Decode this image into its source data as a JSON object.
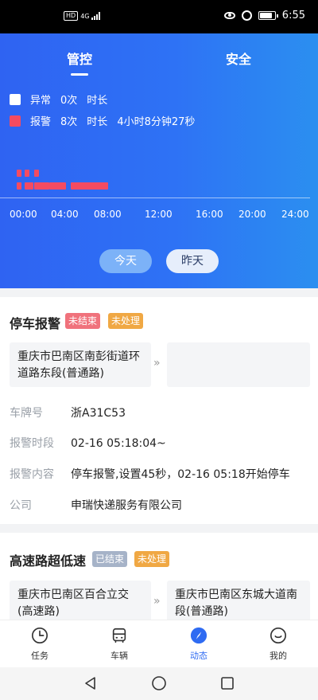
{
  "status_bar": {
    "signal_label": "HD",
    "network": "4G",
    "time": "6:55"
  },
  "tabs": [
    {
      "label": "管控",
      "active": true
    },
    {
      "label": "安全",
      "active": false
    }
  ],
  "legend": [
    {
      "name": "异常",
      "count": "0次",
      "duration_label": "时长",
      "duration": "",
      "color": "#ffffff"
    },
    {
      "name": "报警",
      "count": "8次",
      "duration_label": "时长",
      "duration": "4小时8分钟27秒",
      "color": "#f44b61"
    }
  ],
  "timeline": {
    "ticks": [
      "00:00",
      "04:00",
      "08:00",
      "12:00",
      "16:00",
      "20:00",
      "24:00"
    ],
    "alarm_events_hours": [
      {
        "start": 0.2,
        "end": 0.6,
        "row": 0
      },
      {
        "start": 0.9,
        "end": 1.3,
        "row": 0
      },
      {
        "start": 1.7,
        "end": 2.1,
        "row": 0
      },
      {
        "start": 0.2,
        "end": 0.6,
        "row": 1
      },
      {
        "start": 0.9,
        "end": 1.6,
        "row": 1
      },
      {
        "start": 1.7,
        "end": 3.0,
        "row": 1
      },
      {
        "start": 3.0,
        "end": 4.4,
        "row": 1
      },
      {
        "start": 4.8,
        "end": 8.0,
        "row": 1
      }
    ]
  },
  "day_buttons": {
    "today": "今天",
    "yesterday": "昨天"
  },
  "alarms": [
    {
      "title": "停车报警",
      "badges": [
        {
          "text": "未结束",
          "color": "#f0727c"
        },
        {
          "text": "未处理",
          "color": "#f0a844"
        }
      ],
      "start_location": "重庆市巴南区南彭街道环道路东段(普通路)",
      "end_location": "",
      "separator": "»",
      "fields": [
        {
          "label": "车牌号",
          "value": "浙A31C53"
        },
        {
          "label": "报警时段",
          "value": "02-16 05:18:04~"
        },
        {
          "label": "报警内容",
          "value": "停车报警,设置45秒，02-16 05:18开始停车"
        },
        {
          "label": "公司",
          "value": "申瑞快递服务有限公司"
        }
      ]
    },
    {
      "title": "高速路超低速",
      "badges": [
        {
          "text": "已结束",
          "color": "#a6b3c8"
        },
        {
          "text": "未处理",
          "color": "#f0a844"
        }
      ],
      "start_location": "重庆市巴南区百合立交(高速路)",
      "end_location": "重庆市巴南区东城大道南段(普通路)",
      "separator": "»"
    }
  ],
  "bottom_nav": [
    {
      "label": "任务",
      "icon": "clock-icon",
      "active": false
    },
    {
      "label": "车辆",
      "icon": "bus-icon",
      "active": false
    },
    {
      "label": "动态",
      "icon": "compass-icon",
      "active": true
    },
    {
      "label": "我的",
      "icon": "smile-icon",
      "active": false
    }
  ],
  "colors": {
    "primary": "#2f6bf2",
    "alarm": "#f44b61"
  }
}
